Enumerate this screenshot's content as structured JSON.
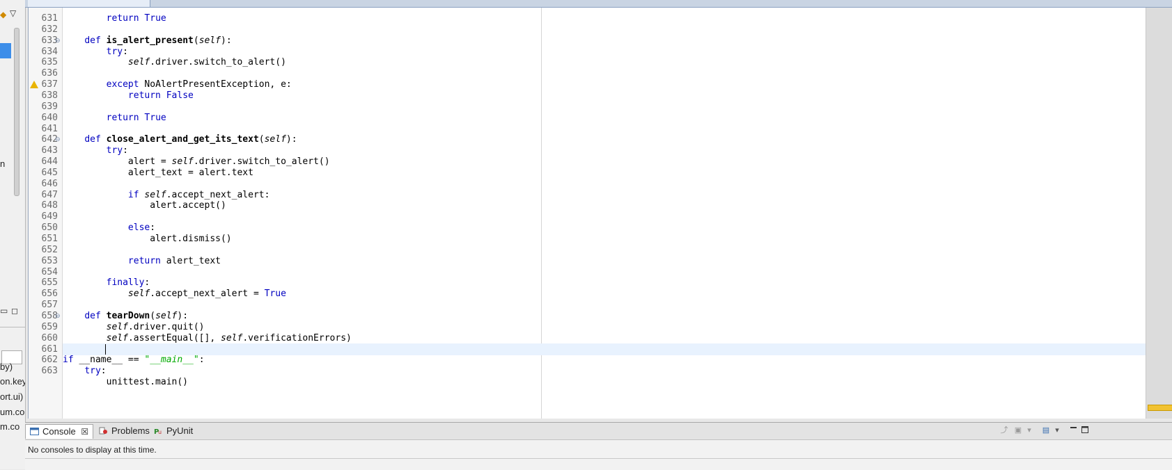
{
  "left_panel": {
    "visible_texts": [
      "n",
      "by)",
      "on.key",
      "ort.ui)",
      "um.co",
      "m.co"
    ]
  },
  "editor": {
    "lines": [
      {
        "n": "631",
        "segs": [
          {
            "t": "        "
          },
          {
            "t": "return True",
            "c": "kw"
          }
        ]
      },
      {
        "n": "632",
        "segs": []
      },
      {
        "n": "633",
        "fold": true,
        "segs": [
          {
            "t": "    "
          },
          {
            "t": "def",
            "c": "kw"
          },
          {
            "t": " "
          },
          {
            "t": "is_alert_present",
            "c": "fn"
          },
          {
            "t": "("
          },
          {
            "t": "self",
            "c": "self"
          },
          {
            "t": "):"
          }
        ]
      },
      {
        "n": "634",
        "segs": [
          {
            "t": "        "
          },
          {
            "t": "try",
            "c": "kw"
          },
          {
            "t": ":"
          }
        ]
      },
      {
        "n": "635",
        "segs": [
          {
            "t": "            "
          },
          {
            "t": "self",
            "c": "self"
          },
          {
            "t": ".driver.switch_to_alert()"
          }
        ]
      },
      {
        "n": "636",
        "segs": []
      },
      {
        "n": "637",
        "warn": true,
        "segs": [
          {
            "t": "        "
          },
          {
            "t": "except",
            "c": "kw"
          },
          {
            "t": " NoAlertPresentException, e:"
          }
        ]
      },
      {
        "n": "638",
        "segs": [
          {
            "t": "            "
          },
          {
            "t": "return False",
            "c": "kw"
          }
        ]
      },
      {
        "n": "639",
        "segs": []
      },
      {
        "n": "640",
        "segs": [
          {
            "t": "        "
          },
          {
            "t": "return True",
            "c": "kw"
          }
        ]
      },
      {
        "n": "641",
        "segs": []
      },
      {
        "n": "642",
        "fold": true,
        "segs": [
          {
            "t": "    "
          },
          {
            "t": "def",
            "c": "kw"
          },
          {
            "t": " "
          },
          {
            "t": "close_alert_and_get_its_text",
            "c": "fn"
          },
          {
            "t": "("
          },
          {
            "t": "self",
            "c": "self"
          },
          {
            "t": "):"
          }
        ]
      },
      {
        "n": "643",
        "segs": [
          {
            "t": "        "
          },
          {
            "t": "try",
            "c": "kw"
          },
          {
            "t": ":"
          }
        ]
      },
      {
        "n": "644",
        "segs": [
          {
            "t": "            alert = "
          },
          {
            "t": "self",
            "c": "self"
          },
          {
            "t": ".driver.switch_to_alert()"
          }
        ]
      },
      {
        "n": "645",
        "segs": [
          {
            "t": "            alert_text = alert.text"
          }
        ]
      },
      {
        "n": "646",
        "segs": []
      },
      {
        "n": "647",
        "segs": [
          {
            "t": "            "
          },
          {
            "t": "if",
            "c": "kw"
          },
          {
            "t": " "
          },
          {
            "t": "self",
            "c": "self"
          },
          {
            "t": ".accept_next_alert:"
          }
        ]
      },
      {
        "n": "648",
        "segs": [
          {
            "t": "                alert.accept()"
          }
        ]
      },
      {
        "n": "649",
        "segs": []
      },
      {
        "n": "650",
        "segs": [
          {
            "t": "            "
          },
          {
            "t": "else",
            "c": "kw"
          },
          {
            "t": ":"
          }
        ]
      },
      {
        "n": "651",
        "segs": [
          {
            "t": "                alert.dismiss()"
          }
        ]
      },
      {
        "n": "652",
        "segs": []
      },
      {
        "n": "653",
        "segs": [
          {
            "t": "            "
          },
          {
            "t": "return",
            "c": "kw"
          },
          {
            "t": " alert_text"
          }
        ]
      },
      {
        "n": "654",
        "segs": []
      },
      {
        "n": "655",
        "segs": [
          {
            "t": "        "
          },
          {
            "t": "finally",
            "c": "kw"
          },
          {
            "t": ":"
          }
        ]
      },
      {
        "n": "656",
        "segs": [
          {
            "t": "            "
          },
          {
            "t": "self",
            "c": "self"
          },
          {
            "t": ".accept_next_alert = "
          },
          {
            "t": "True",
            "c": "kw"
          }
        ]
      },
      {
        "n": "657",
        "segs": []
      },
      {
        "n": "658",
        "fold": true,
        "segs": [
          {
            "t": "    "
          },
          {
            "t": "def",
            "c": "kw"
          },
          {
            "t": " "
          },
          {
            "t": "tearDown",
            "c": "fn"
          },
          {
            "t": "("
          },
          {
            "t": "self",
            "c": "self"
          },
          {
            "t": "):"
          }
        ]
      },
      {
        "n": "659",
        "segs": [
          {
            "t": "        "
          },
          {
            "t": "self",
            "c": "self"
          },
          {
            "t": ".driver.quit()"
          }
        ]
      },
      {
        "n": "660",
        "segs": [
          {
            "t": "        "
          },
          {
            "t": "self",
            "c": "self"
          },
          {
            "t": ".assertEqual([], "
          },
          {
            "t": "self",
            "c": "self"
          },
          {
            "t": ".verificationErrors)"
          }
        ]
      },
      {
        "n": "661",
        "current": true,
        "segs": [
          {
            "t": "        "
          }
        ]
      },
      {
        "n": "662",
        "segs": [
          {
            "t": "if",
            "c": "kw"
          },
          {
            "t": " __name__ == "
          },
          {
            "t": "\"__main__\"",
            "c": "str"
          },
          {
            "t": ":"
          }
        ]
      },
      {
        "n": "663",
        "segs": [
          {
            "t": "    "
          },
          {
            "t": "try",
            "c": "kw"
          },
          {
            "t": ":"
          }
        ]
      },
      {
        "n": "",
        "segs": [
          {
            "t": "        unittest.main()"
          }
        ]
      }
    ],
    "colors": {
      "keyword": "#0000c0",
      "string": "#00aa00",
      "current_line": "#e8f2fe",
      "warning": "#e9b400"
    }
  },
  "console_panel": {
    "tabs": [
      {
        "label": "Console",
        "icon": "console-icon",
        "active": true
      },
      {
        "label": "Problems",
        "icon": "problems-icon",
        "active": false
      },
      {
        "label": "PyUnit",
        "icon": "pyunit-icon",
        "active": false
      }
    ],
    "close_glyph": "☒",
    "message": "No consoles to display at this time."
  }
}
